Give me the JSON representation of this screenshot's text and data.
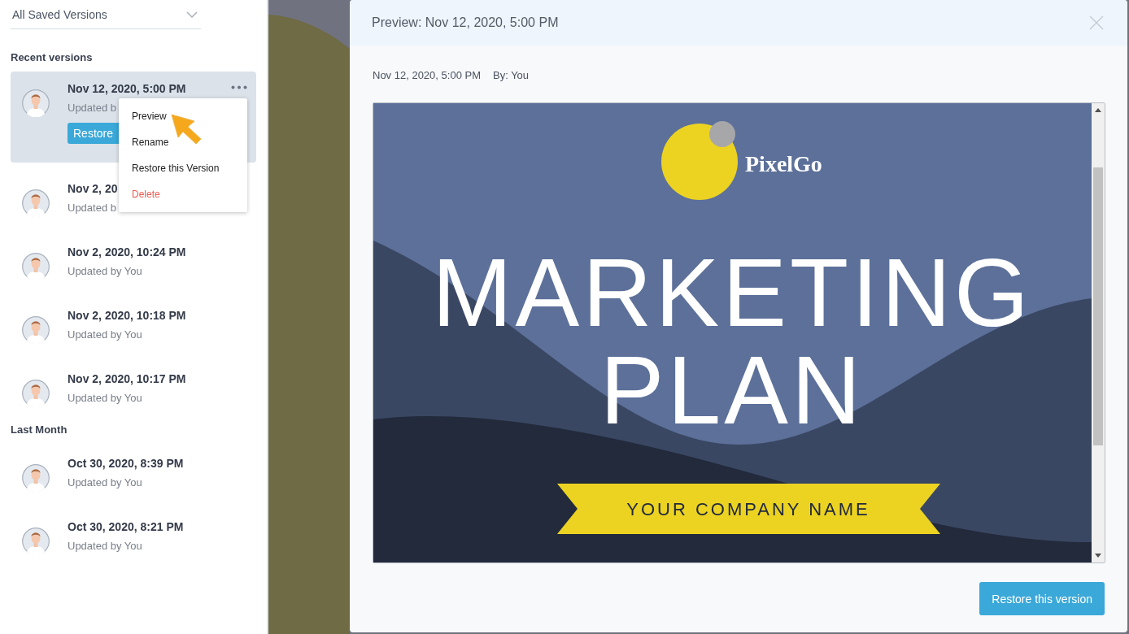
{
  "sidebar": {
    "filter": {
      "value": "All Saved Versions"
    },
    "groups": [
      {
        "heading": "Recent versions",
        "versions": [
          {
            "date": "Nov 12, 2020, 5:00 PM",
            "subtitle": "Updated b",
            "selected": true,
            "button": "Restore"
          },
          {
            "date": "Nov 2, 20",
            "subtitle": "Updated b",
            "selected": false
          },
          {
            "date": "Nov 2, 2020, 10:24 PM",
            "subtitle": "Updated by You",
            "selected": false
          },
          {
            "date": "Nov 2, 2020, 10:18 PM",
            "subtitle": "Updated by You",
            "selected": false
          },
          {
            "date": "Nov 2, 2020, 10:17 PM",
            "subtitle": "Updated by You",
            "selected": false
          }
        ]
      },
      {
        "heading": "Last Month",
        "versions": [
          {
            "date": "Oct 30, 2020, 8:39 PM",
            "subtitle": "Updated by You",
            "selected": false
          },
          {
            "date": "Oct 30, 2020, 8:21 PM",
            "subtitle": "Updated by You",
            "selected": false
          }
        ]
      }
    ]
  },
  "context_menu": {
    "items": [
      {
        "label": "Preview",
        "kind": "normal"
      },
      {
        "label": "Rename",
        "kind": "normal"
      },
      {
        "label": "Restore this Version",
        "kind": "normal"
      },
      {
        "label": "Delete",
        "kind": "danger"
      }
    ]
  },
  "modal": {
    "title": "Preview: Nov 12, 2020, 5:00 PM",
    "meta_date": "Nov 12, 2020, 5:00 PM",
    "meta_author": "By: You",
    "slide": {
      "logo": "PixelGo",
      "title_lines": [
        "MARKETING",
        "PLAN"
      ],
      "company": "YOUR COMPANY NAME"
    },
    "restore_button": "Restore this version"
  }
}
